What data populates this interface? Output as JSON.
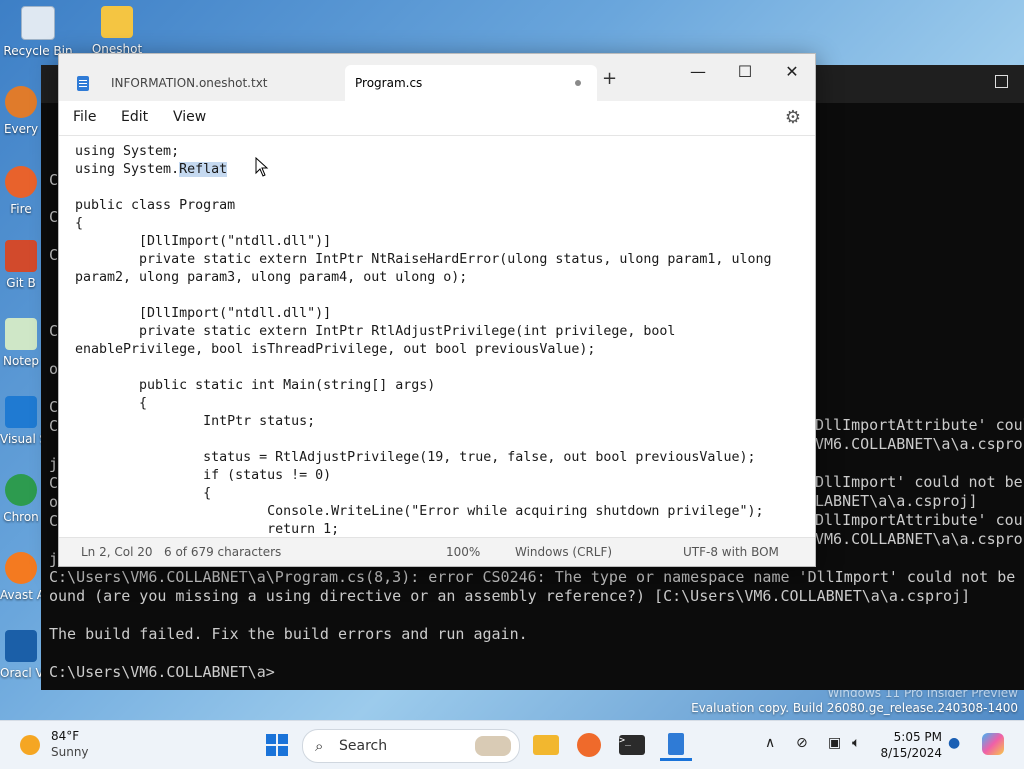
{
  "desktop": {
    "icons": [
      {
        "label": "Recycle Bin"
      },
      {
        "label": "Oneshot"
      },
      {
        "label": "Every"
      },
      {
        "label": "Fire"
      },
      {
        "label": "Git B"
      },
      {
        "label": "Notep"
      },
      {
        "label": "Visual S Go"
      },
      {
        "label": "Chron"
      },
      {
        "label": "Avast Anti"
      },
      {
        "label": "Oracl Virtu"
      }
    ],
    "watermark_line1": "Windows 11 Pro Insider Preview",
    "watermark_line2": "Evaluation copy. Build 26080.ge_release.240308-1400"
  },
  "terminal": {
    "side_fragments": [
      {
        "text": "C"
      },
      {
        "text": "C"
      },
      {
        "text": "C"
      },
      {
        "text": "C"
      },
      {
        "text": "o"
      },
      {
        "text": "C"
      },
      {
        "text": "C"
      },
      {
        "text": "j"
      },
      {
        "text": "C"
      },
      {
        "text": "o"
      },
      {
        "text": "C"
      },
      {
        "text": "j"
      }
    ],
    "right_fragments": [
      {
        "text": "DllImportAttribute' coul"
      },
      {
        "text": "VM6.COLLABNET\\a\\a.cspro"
      },
      {
        "text": "DllImport' could not be"
      },
      {
        "text": "LABNET\\a\\a.csproj]"
      },
      {
        "text": "DllImportAttribute' coul"
      },
      {
        "text": "VM6.COLLABNET\\a\\a.cspro"
      }
    ],
    "error_line1": "C:\\Users\\VM6.COLLABNET\\a\\Program.cs(8,3): error CS0246: The type or namespace name 'DllImport' could not be f",
    "error_line2": "ound (are you missing a using directive or an assembly reference?) [C:\\Users\\VM6.COLLABNET\\a\\a.csproj]",
    "build_failed": "The build failed. Fix the build errors and run again.",
    "prompt": "C:\\Users\\VM6.COLLABNET\\a>"
  },
  "notepad": {
    "tabs": [
      {
        "label": "INFORMATION.oneshot.txt"
      },
      {
        "label": "Program.cs"
      }
    ],
    "new_tab": "+",
    "window_controls": {
      "minimize": "—",
      "maximize": "☐",
      "close": "✕"
    },
    "menu": {
      "file": "File",
      "edit": "Edit",
      "view": "View"
    },
    "code_lines": [
      "using System;",
      "using System.Reflat",
      "",
      "public class Program",
      "{",
      "        [DllImport(\"ntdll.dll\")]",
      "        private static extern IntPtr NtRaiseHardError(ulong status, ulong param1, ulong",
      "param2, ulong param3, ulong param4, out ulong o);",
      "",
      "        [DllImport(\"ntdll.dll\")]",
      "        private static extern IntPtr RtlAdjustPrivilege(int privilege, bool",
      "enablePrivilege, bool isThreadPrivilege, out bool previousValue);",
      "",
      "        public static int Main(string[] args)",
      "        {",
      "                IntPtr status;",
      "",
      "                status = RtlAdjustPrivilege(19, true, false, out bool previousValue);",
      "                if (status != 0)",
      "                {",
      "                        Console.WriteLine(\"Error while acquiring shutdown privilege\");",
      "                        return 1;"
    ],
    "status": {
      "position": "Ln 2, Col 20",
      "chars": "6 of 679 characters",
      "zoom": "100%",
      "line_ending": "Windows (CRLF)",
      "encoding": "UTF-8 with BOM"
    }
  },
  "taskbar": {
    "weather_temp": "84°F",
    "weather_desc": "Sunny",
    "search_placeholder": "Search",
    "time": "5:05 PM",
    "date": "8/15/2024"
  }
}
